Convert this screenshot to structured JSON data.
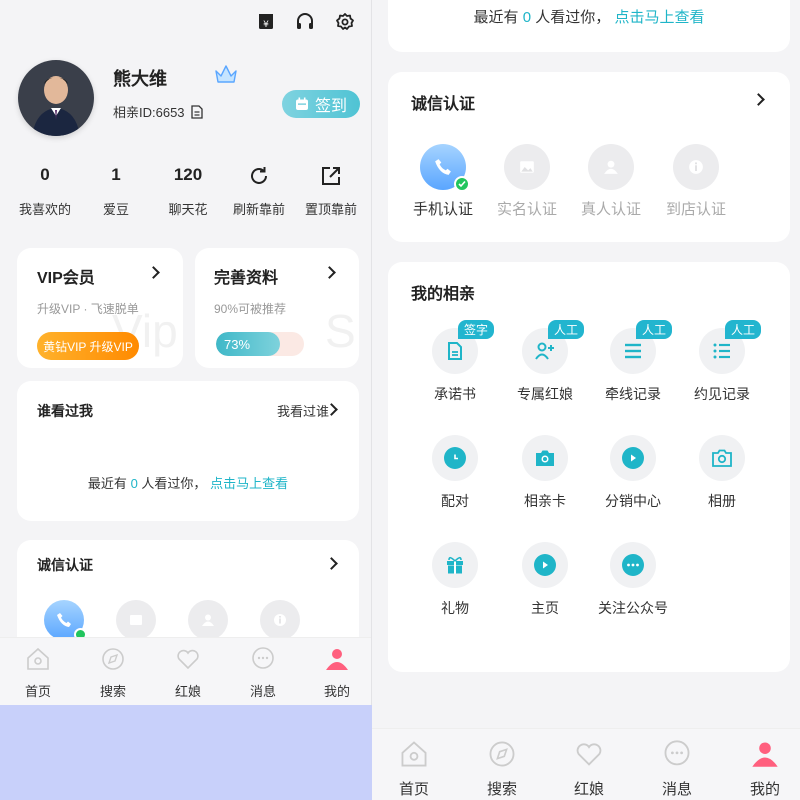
{
  "header": {
    "icons": [
      "wallet-icon",
      "headset-icon",
      "settings-icon"
    ]
  },
  "profile": {
    "name": "熊大维",
    "id_label": "相亲ID:6653",
    "signin_label": "签到"
  },
  "stats": [
    {
      "num": "0",
      "label": "我喜欢的"
    },
    {
      "num": "1",
      "label": "爱豆"
    },
    {
      "num": "120",
      "label": "聊天花"
    },
    {
      "num": "",
      "label": "刷新靠前"
    },
    {
      "num": "",
      "label": "置顶靠前"
    }
  ],
  "vip_card": {
    "title": "VIP会员",
    "subtitle": "升级VIP · 飞速脱单",
    "button": "黄钻VIP 升级VIP",
    "ghost": "Vip"
  },
  "profile_card": {
    "title": "完善资料",
    "subtitle": "90%可被推荐",
    "progress_label": "73%",
    "progress": 0.73,
    "ghost": "S"
  },
  "visitors": {
    "title": "谁看过我",
    "link": "我看过谁",
    "text_prefix": "最近有",
    "count": "0",
    "text_suffix": "人看过你，",
    "cta": "点击马上查看"
  },
  "verification": {
    "title": "诚信认证",
    "items": [
      {
        "label": "手机认证",
        "active": true
      },
      {
        "label": "实名认证",
        "active": false
      },
      {
        "label": "真人认证",
        "active": false
      },
      {
        "label": "到店认证",
        "active": false
      }
    ]
  },
  "my_dating": {
    "title": "我的相亲",
    "items": [
      {
        "label": "承诺书",
        "tag": "签字"
      },
      {
        "label": "专属红娘",
        "tag": "人工"
      },
      {
        "label": "牵线记录",
        "tag": "人工"
      },
      {
        "label": "约见记录",
        "tag": "人工"
      },
      {
        "label": "配对",
        "tag": ""
      },
      {
        "label": "相亲卡",
        "tag": ""
      },
      {
        "label": "分销中心",
        "tag": ""
      },
      {
        "label": "相册",
        "tag": ""
      },
      {
        "label": "礼物",
        "tag": ""
      },
      {
        "label": "主页",
        "tag": ""
      },
      {
        "label": "关注公众号",
        "tag": ""
      }
    ]
  },
  "tabs": [
    {
      "label": "首页"
    },
    {
      "label": "搜索"
    },
    {
      "label": "红娘"
    },
    {
      "label": "消息"
    },
    {
      "label": "我的",
      "active": true
    }
  ],
  "colors": {
    "accent": "#1fb5c8",
    "active_tab": "#ff5f7e",
    "vip": "#ff8a00"
  }
}
